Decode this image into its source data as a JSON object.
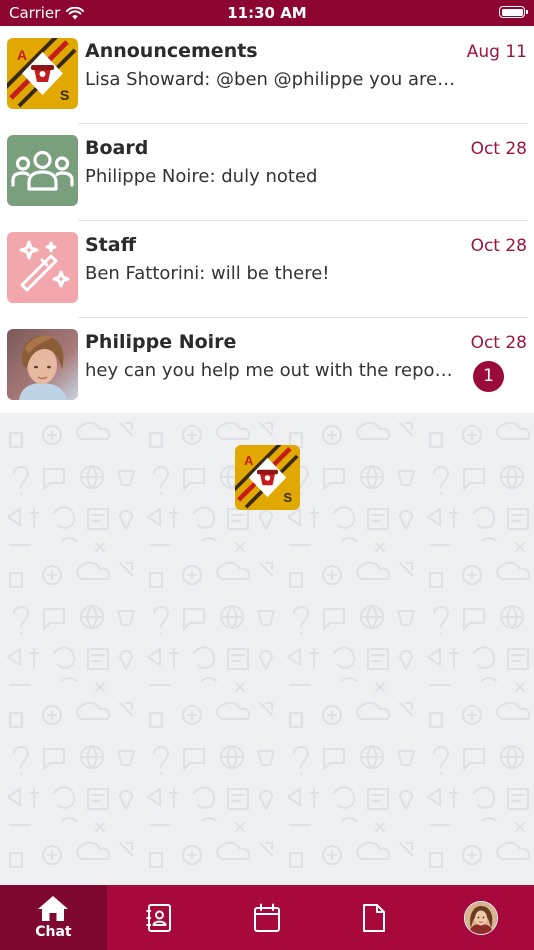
{
  "status_bar": {
    "carrier": "Carrier",
    "time": "11:30 AM",
    "battery_level": 1.0,
    "background_color": "#8c0631"
  },
  "chats": [
    {
      "title": "Announcements",
      "preview": "Lisa Showard: @ben @philippe you are going to want to see this",
      "date": "Aug 11",
      "avatar": "org-logo",
      "unread": ""
    },
    {
      "title": "Board",
      "preview": "Philippe Noire: duly noted",
      "date": "Oct 28",
      "avatar": "group-people-icon",
      "unread": ""
    },
    {
      "title": "Staff",
      "preview": "Ben Fattorini: will be there!",
      "date": "Oct 28",
      "avatar": "magic-wand-icon",
      "unread": ""
    },
    {
      "title": "Philippe Noire",
      "preview": "hey can you help me out with the report?",
      "date": "Oct 28",
      "avatar": "user-photo",
      "unread": "1"
    }
  ],
  "logo": {
    "letter_top": "A",
    "letter_bottom": "S"
  },
  "tabs": [
    {
      "icon": "home-icon",
      "label": "Chat",
      "active": true
    },
    {
      "icon": "contacts-icon",
      "label": "",
      "active": false
    },
    {
      "icon": "calendar-icon",
      "label": "",
      "active": false
    },
    {
      "icon": "document-icon",
      "label": "",
      "active": false
    },
    {
      "icon": "profile-avatar",
      "label": "",
      "active": false
    }
  ],
  "colors": {
    "accent": "#a8093d",
    "date_text": "#9c1442",
    "board_avatar": "#7a9f7d",
    "staff_avatar": "#f1a7ac",
    "logo_gold": "#e0a800"
  }
}
